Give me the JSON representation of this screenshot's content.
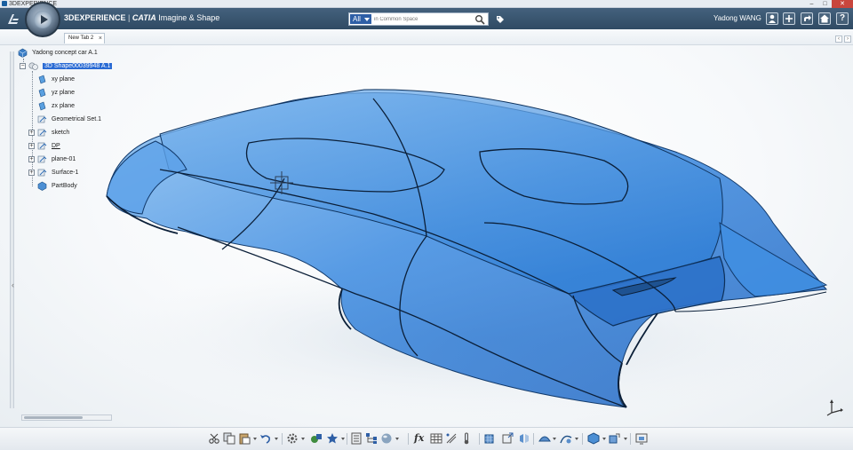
{
  "window": {
    "os_title": "3DEXPERIENCE"
  },
  "header": {
    "brand": "3DEXPERIENCE",
    "separator": "|",
    "product": "CATIA",
    "app_name": "Imagine & Shape",
    "search": {
      "filter": "All",
      "placeholder": "in Common Space"
    },
    "user": "Yadong WANG",
    "buttons": [
      "user-icon",
      "add-icon",
      "share-icon",
      "home-icon",
      "help-icon"
    ],
    "help_label": "?"
  },
  "tabs": [
    {
      "label": "New Tab 2",
      "close": "×"
    }
  ],
  "tree": {
    "root": "Yadong concept car A.1",
    "product": "3D Shape00039948 A.1",
    "children": [
      {
        "label": "xy plane",
        "icon": "plane-icon"
      },
      {
        "label": "yz plane",
        "icon": "plane-icon"
      },
      {
        "label": "zx plane",
        "icon": "plane-icon"
      },
      {
        "label": "Geometrical Set.1",
        "icon": "geometrical-set-icon"
      },
      {
        "label": "sketch",
        "icon": "geometrical-set-icon"
      },
      {
        "label": "DP",
        "icon": "geometrical-set-icon"
      },
      {
        "label": "plane-01",
        "icon": "geometrical-set-icon"
      },
      {
        "label": "Surface-1",
        "icon": "geometrical-set-icon"
      },
      {
        "label": "PartBody",
        "icon": "part-body-icon"
      }
    ]
  },
  "colors": {
    "header": "#3a5672",
    "surface": "#2f7fd6",
    "selection": "#2a6bd4"
  },
  "toolbar": {
    "formula_label": "fx",
    "icons": [
      "cut-icon",
      "copy-icon",
      "paste-icon",
      "undo-icon",
      "settings-icon",
      "insert-icon",
      "favorite-icon",
      "catalog-icon",
      "tree-icon",
      "render-icon",
      "formula-icon",
      "table-icon",
      "measure-icon",
      "thermometer-icon",
      "subdivision-icon",
      "transform-icon",
      "mirror-icon",
      "symmetry-icon",
      "curve-icon",
      "shape-icon",
      "modify-icon",
      "capture-icon"
    ]
  }
}
